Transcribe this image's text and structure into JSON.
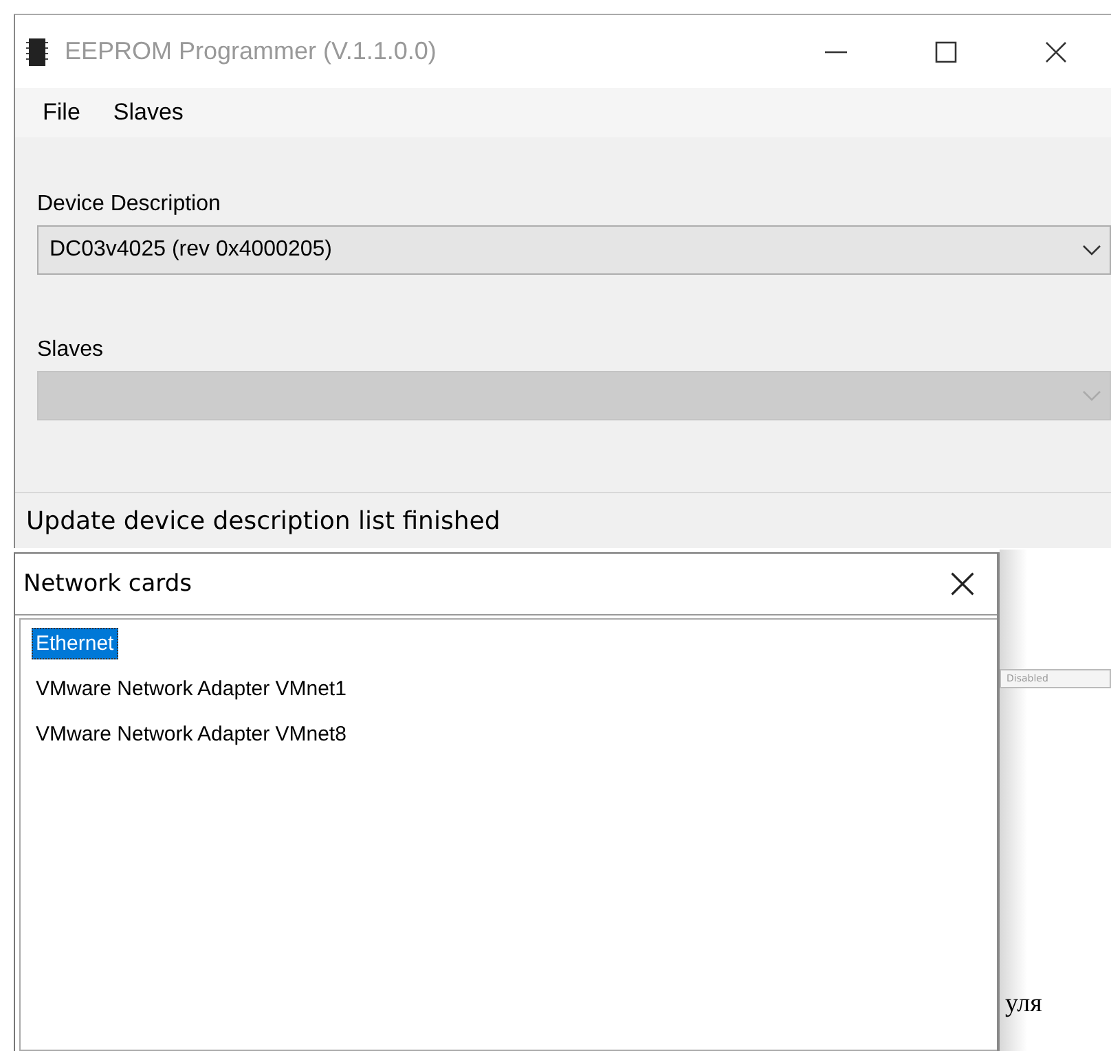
{
  "window": {
    "title": "EEPROM Programmer (V.1.1.0.0)"
  },
  "menu": [
    "File",
    "Slaves"
  ],
  "fields": [
    {
      "label": "Device Description",
      "value": "DC03v4025 (rev 0x4000205)",
      "disabled": false
    },
    {
      "label": "Slaves",
      "disabled": true
    }
  ],
  "status_bar": "Update device description list finished",
  "dialog": {
    "title": "Network cards",
    "items": [
      {
        "label": "Ethernet",
        "selected": true
      },
      {
        "label": "VMware Network Adapter VMnet1",
        "selected": false
      },
      {
        "label": "VMware Network Adapter VMnet8",
        "selected": false
      }
    ]
  },
  "background_document": {
    "field_text": "Disabled",
    "text": "уля"
  }
}
